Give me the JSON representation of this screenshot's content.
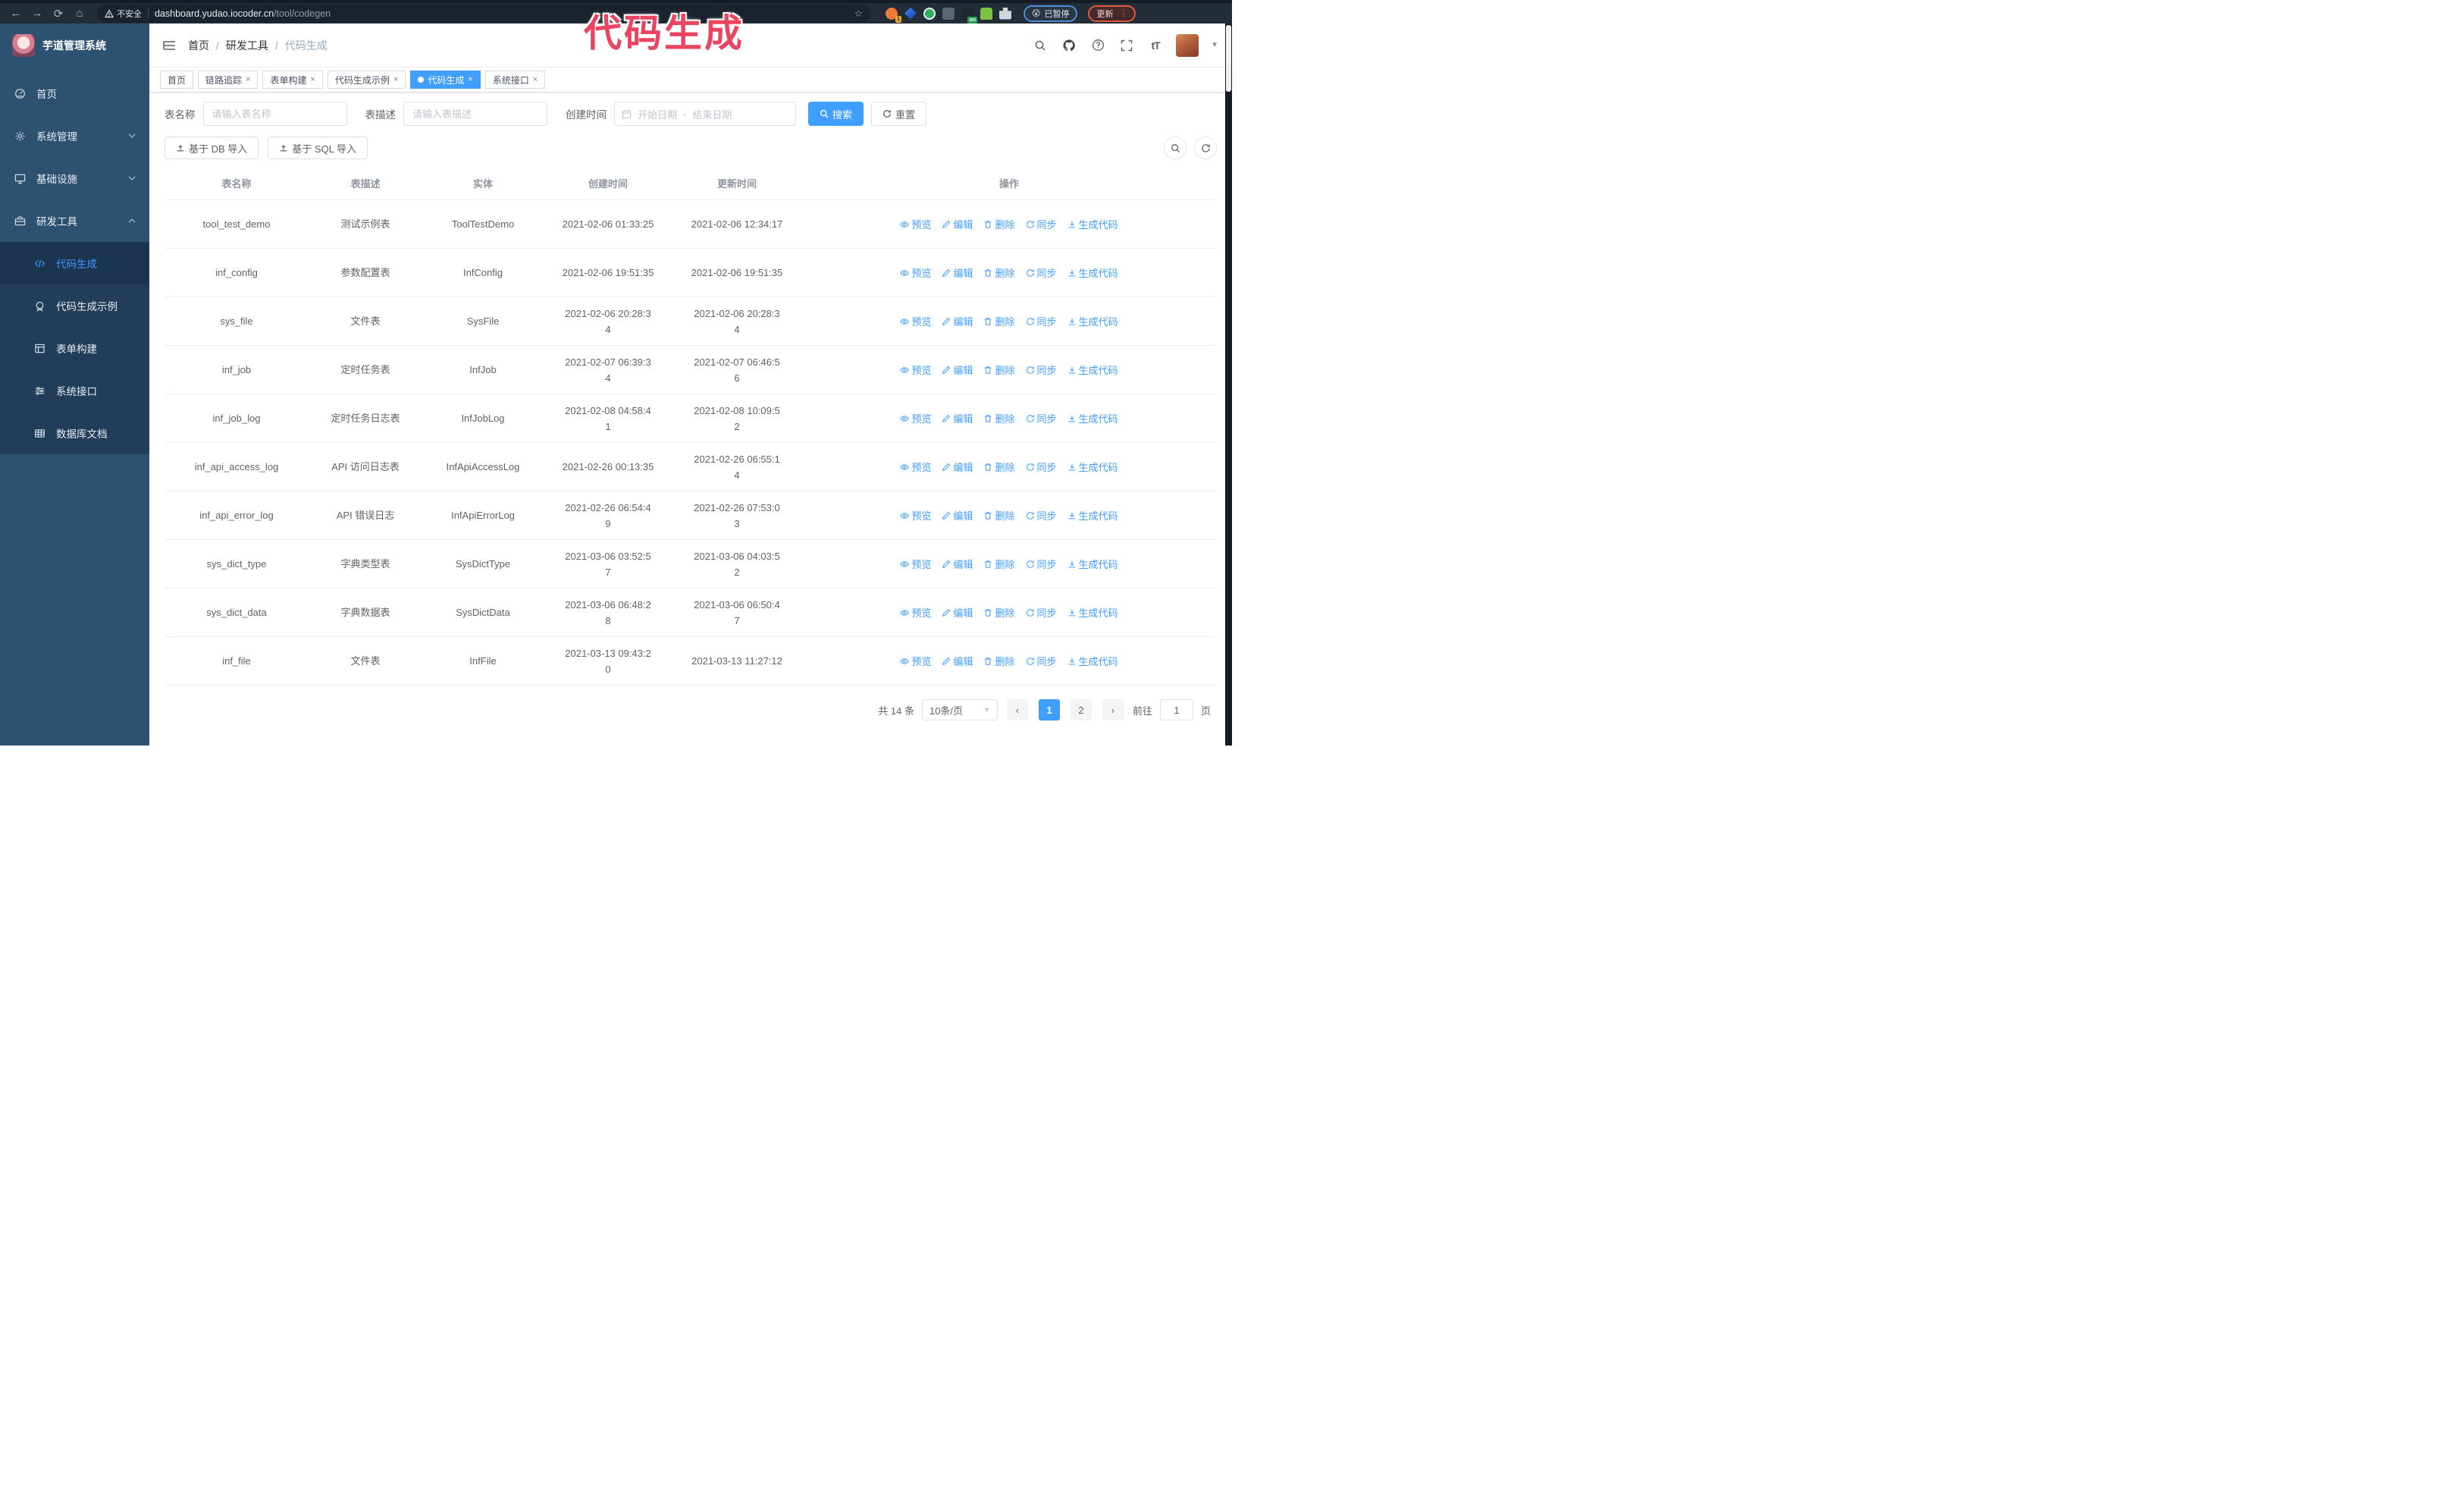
{
  "browser": {
    "security_label": "不安全",
    "url_host": "dashboard.yudao.iocoder.cn",
    "url_path": "/tool/codegen",
    "ext_badge": "1",
    "ext_on_badge": "on",
    "paused_label": "已暂停",
    "paused_emoji": "😲",
    "update_label": "更新"
  },
  "annotation": {
    "text": "代码生成"
  },
  "app": {
    "title": "芋道管理系统",
    "breadcrumb": {
      "home": "首页",
      "group": "研发工具",
      "current": "代码生成",
      "separator": "/"
    }
  },
  "sidebar": {
    "items": [
      {
        "label": "首页"
      },
      {
        "label": "系统管理"
      },
      {
        "label": "基础设施"
      },
      {
        "label": "研发工具"
      }
    ],
    "subitems": [
      {
        "label": "代码生成"
      },
      {
        "label": "代码生成示例"
      },
      {
        "label": "表单构建"
      },
      {
        "label": "系统接口"
      },
      {
        "label": "数据库文档"
      }
    ]
  },
  "tabs": {
    "items": [
      {
        "label": "首页"
      },
      {
        "label": "链路追踪"
      },
      {
        "label": "表单构建"
      },
      {
        "label": "代码生成示例"
      },
      {
        "label": "代码生成"
      },
      {
        "label": "系统接口"
      }
    ],
    "close_glyph": "×"
  },
  "filters": {
    "name_label": "表名称",
    "name_placeholder": "请输入表名称",
    "desc_label": "表描述",
    "desc_placeholder": "请输入表描述",
    "time_label": "创建时间",
    "start_placeholder": "开始日期",
    "range_separator": "-",
    "end_placeholder": "结束日期",
    "search_label": "搜索",
    "reset_label": "重置"
  },
  "toolbar": {
    "import_db_label": "基于 DB 导入",
    "import_sql_label": "基于 SQL 导入"
  },
  "table": {
    "headers": [
      "表名称",
      "表描述",
      "实体",
      "创建时间",
      "更新时间",
      "操作"
    ],
    "actions": [
      "预览",
      "编辑",
      "删除",
      "同步",
      "生成代码"
    ],
    "rows": [
      {
        "name": "tool_test_demo",
        "desc": "测试示例表",
        "entity": "ToolTestDemo",
        "created": "2021-02-06 01:33:25",
        "updated": "2021-02-06 12:34:17"
      },
      {
        "name": "inf_config",
        "desc": "参数配置表",
        "entity": "InfConfig",
        "created": "2021-02-06 19:51:35",
        "updated": "2021-02-06 19:51:35"
      },
      {
        "name": "sys_file",
        "desc": "文件表",
        "entity": "SysFile",
        "created": "2021-02-06 20:28:3\n4",
        "updated": "2021-02-06 20:28:3\n4"
      },
      {
        "name": "inf_job",
        "desc": "定时任务表",
        "entity": "InfJob",
        "created": "2021-02-07 06:39:3\n4",
        "updated": "2021-02-07 06:46:5\n6"
      },
      {
        "name": "inf_job_log",
        "desc": "定时任务日志表",
        "entity": "InfJobLog",
        "created": "2021-02-08 04:58:4\n1",
        "updated": "2021-02-08 10:09:5\n2"
      },
      {
        "name": "inf_api_access_log",
        "desc": "API 访问日志表",
        "entity": "InfApiAccessLog",
        "created": "2021-02-26 00:13:35",
        "updated": "2021-02-26 06:55:1\n4"
      },
      {
        "name": "inf_api_error_log",
        "desc": "API 错误日志",
        "entity": "InfApiErrorLog",
        "created": "2021-02-26 06:54:4\n9",
        "updated": "2021-02-26 07:53:0\n3"
      },
      {
        "name": "sys_dict_type",
        "desc": "字典类型表",
        "entity": "SysDictType",
        "created": "2021-03-06 03:52:5\n7",
        "updated": "2021-03-06 04:03:5\n2"
      },
      {
        "name": "sys_dict_data",
        "desc": "字典数据表",
        "entity": "SysDictData",
        "created": "2021-03-06 06:48:2\n8",
        "updated": "2021-03-06 06:50:4\n7"
      },
      {
        "name": "inf_file",
        "desc": "文件表",
        "entity": "InfFile",
        "created": "2021-03-13 09:43:2\n0",
        "updated": "2021-03-13 11:27:12"
      }
    ]
  },
  "pagination": {
    "total_label": "共 14 条",
    "page_size_label": "10条/页",
    "prev_glyph": "‹",
    "next_glyph": "›",
    "pages": [
      "1",
      "2"
    ],
    "goto_label": "前往",
    "goto_value": "1",
    "page_unit": "页"
  },
  "colors": {
    "primary": "#409eff",
    "sidebar_bg": "#2d5170",
    "submenu_bg": "#213d59",
    "annotation_pink": "#ea4460",
    "browser_bg": "#222d38"
  }
}
